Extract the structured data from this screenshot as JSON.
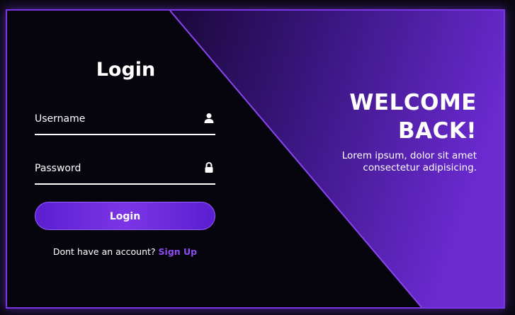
{
  "login": {
    "title": "Login",
    "username_label": "Username",
    "password_label": "Password",
    "button_label": "Login",
    "signup_prompt": "Dont have an account?",
    "signup_link": "Sign Up"
  },
  "welcome": {
    "line1": "WELCOME",
    "line2": "BACK!",
    "text": "Lorem ipsum, dolor sit amet consectetur adipisicing."
  },
  "icons": {
    "username": "user-icon",
    "password": "lock-icon"
  },
  "colors": {
    "accent": "#7b35e6",
    "background": "#06040c",
    "link": "#8f4cf0"
  }
}
